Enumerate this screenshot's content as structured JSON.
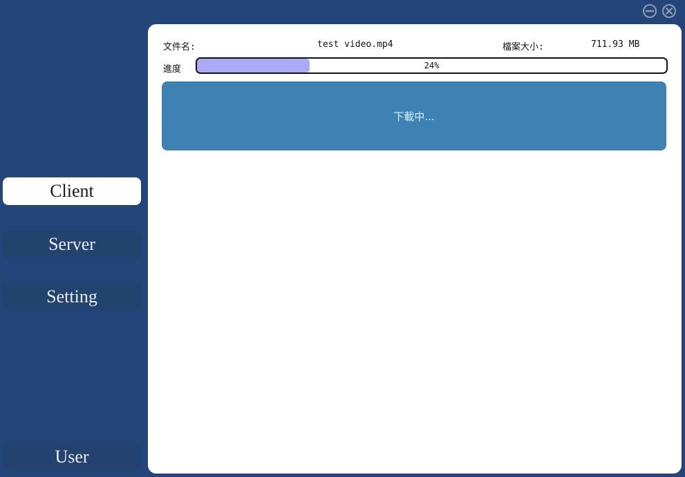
{
  "window": {
    "minimize_icon": "minimize-icon",
    "close_icon": "close-icon"
  },
  "sidebar": {
    "items": [
      {
        "label": "Client",
        "active": true
      },
      {
        "label": "Server",
        "active": false
      },
      {
        "label": "Setting",
        "active": false
      }
    ],
    "user_label": "User"
  },
  "file": {
    "name_label": "文件名:",
    "name": "test video.mp4",
    "size_label": "檔案大小:",
    "size": "711.93 MB"
  },
  "progress": {
    "label": "進度",
    "percent": 24,
    "text": "24%"
  },
  "action": {
    "label": "下載中..."
  },
  "colors": {
    "background": "#24457a",
    "panel": "#ffffff",
    "progress_fill": "#aaaaf7",
    "button": "#3d82b2",
    "button_text": "#d8f0ff"
  }
}
